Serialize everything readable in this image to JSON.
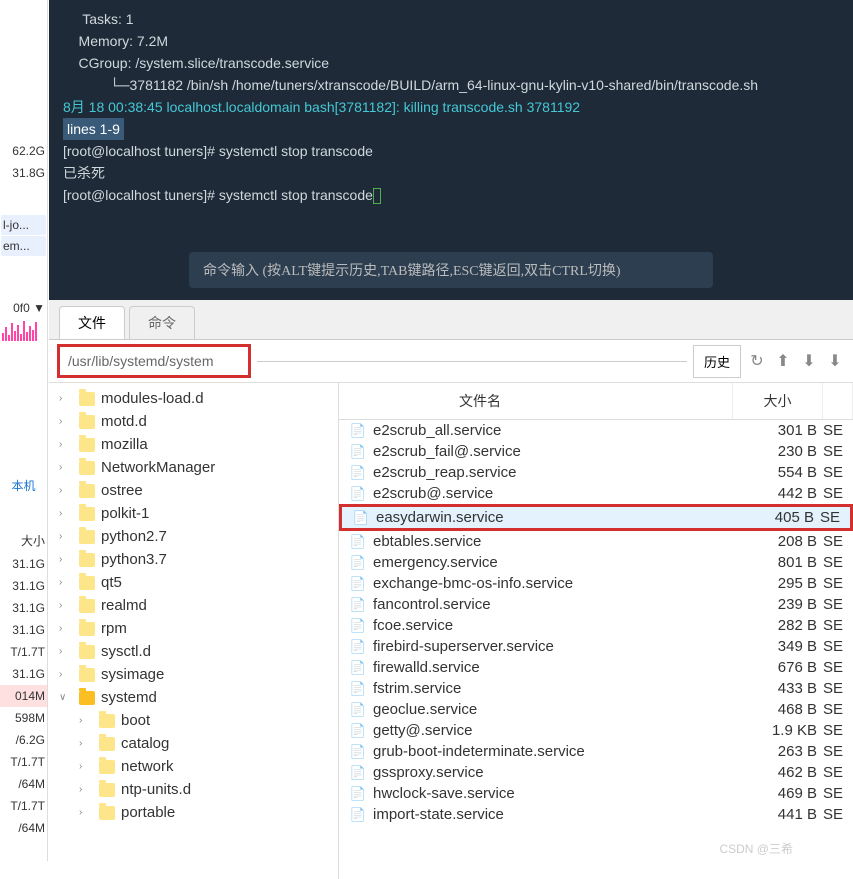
{
  "left_sidebar": {
    "items": [
      "",
      "62.2G",
      "31.8G",
      "",
      "l-jo...",
      "em...",
      "",
      "",
      "0f0 ▼"
    ],
    "label_local": "本机",
    "sizes": [
      "大小",
      "31.1G",
      "31.1G",
      "31.1G",
      "31.1G",
      "T/1.7T",
      "31.1G",
      "014M",
      "598M",
      "/6.2G",
      "T/1.7T",
      "/64M",
      "T/1.7T",
      "/64M"
    ]
  },
  "terminal": {
    "lines": [
      "     Tasks: 1",
      "    Memory: 7.2M",
      "    CGroup: /system.slice/transcode.service",
      "            └─3781182 /bin/sh /home/tuners/xtranscode/BUILD/arm_64-linux-gnu-kylin-v10-shared/bin/transcode.sh",
      "",
      "8月 18 00:38:45 localhost.localdomain bash[3781182]: killing transcode.sh 3781192"
    ],
    "highlight": "lines 1-9",
    "prompt1": "[root@localhost tuners]# systemctl stop transcode",
    "killed": "已杀死",
    "prompt2": "[root@localhost tuners]# systemctl stop transcode",
    "cmd_hint": "命令输入 (按ALT键提示历史,TAB键路径,ESC键返回,双击CTRL切换)"
  },
  "tabs": {
    "file": "文件",
    "cmd": "命令"
  },
  "path": "/usr/lib/systemd/system",
  "history_btn": "历史",
  "tree": [
    {
      "name": "modules-load.d",
      "child": false
    },
    {
      "name": "motd.d",
      "child": false
    },
    {
      "name": "mozilla",
      "child": false
    },
    {
      "name": "NetworkManager",
      "child": false
    },
    {
      "name": "ostree",
      "child": false
    },
    {
      "name": "polkit-1",
      "child": false
    },
    {
      "name": "python2.7",
      "child": false
    },
    {
      "name": "python3.7",
      "child": false
    },
    {
      "name": "qt5",
      "child": false
    },
    {
      "name": "realmd",
      "child": false
    },
    {
      "name": "rpm",
      "child": false
    },
    {
      "name": "sysctl.d",
      "child": false
    },
    {
      "name": "sysimage",
      "child": false
    },
    {
      "name": "systemd",
      "child": false,
      "open": true,
      "expand": "∨"
    },
    {
      "name": "boot",
      "child": true
    },
    {
      "name": "catalog",
      "child": true
    },
    {
      "name": "network",
      "child": true
    },
    {
      "name": "ntp-units.d",
      "child": true
    },
    {
      "name": "portable",
      "child": true
    }
  ],
  "list_header": {
    "name": "文件名",
    "size": "大小"
  },
  "files": [
    {
      "name": "e2scrub_all.service",
      "size": "301 B",
      "x": "SE"
    },
    {
      "name": "e2scrub_fail@.service",
      "size": "230 B",
      "x": "SE"
    },
    {
      "name": "e2scrub_reap.service",
      "size": "554 B",
      "x": "SE"
    },
    {
      "name": "e2scrub@.service",
      "size": "442 B",
      "x": "SE"
    },
    {
      "name": "easydarwin.service",
      "size": "405 B",
      "x": "SE",
      "highlighted": true
    },
    {
      "name": "ebtables.service",
      "size": "208 B",
      "x": "SE"
    },
    {
      "name": "emergency.service",
      "size": "801 B",
      "x": "SE"
    },
    {
      "name": "exchange-bmc-os-info.service",
      "size": "295 B",
      "x": "SE"
    },
    {
      "name": "fancontrol.service",
      "size": "239 B",
      "x": "SE"
    },
    {
      "name": "fcoe.service",
      "size": "282 B",
      "x": "SE"
    },
    {
      "name": "firebird-superserver.service",
      "size": "349 B",
      "x": "SE"
    },
    {
      "name": "firewalld.service",
      "size": "676 B",
      "x": "SE"
    },
    {
      "name": "fstrim.service",
      "size": "433 B",
      "x": "SE"
    },
    {
      "name": "geoclue.service",
      "size": "468 B",
      "x": "SE"
    },
    {
      "name": "getty@.service",
      "size": "1.9 KB",
      "x": "SE"
    },
    {
      "name": "grub-boot-indeterminate.service",
      "size": "263 B",
      "x": "SE"
    },
    {
      "name": "gssproxy.service",
      "size": "462 B",
      "x": "SE"
    },
    {
      "name": "hwclock-save.service",
      "size": "469 B",
      "x": "SE"
    },
    {
      "name": "import-state.service",
      "size": "441 B",
      "x": "SE"
    }
  ],
  "watermark": "CSDN @三希"
}
